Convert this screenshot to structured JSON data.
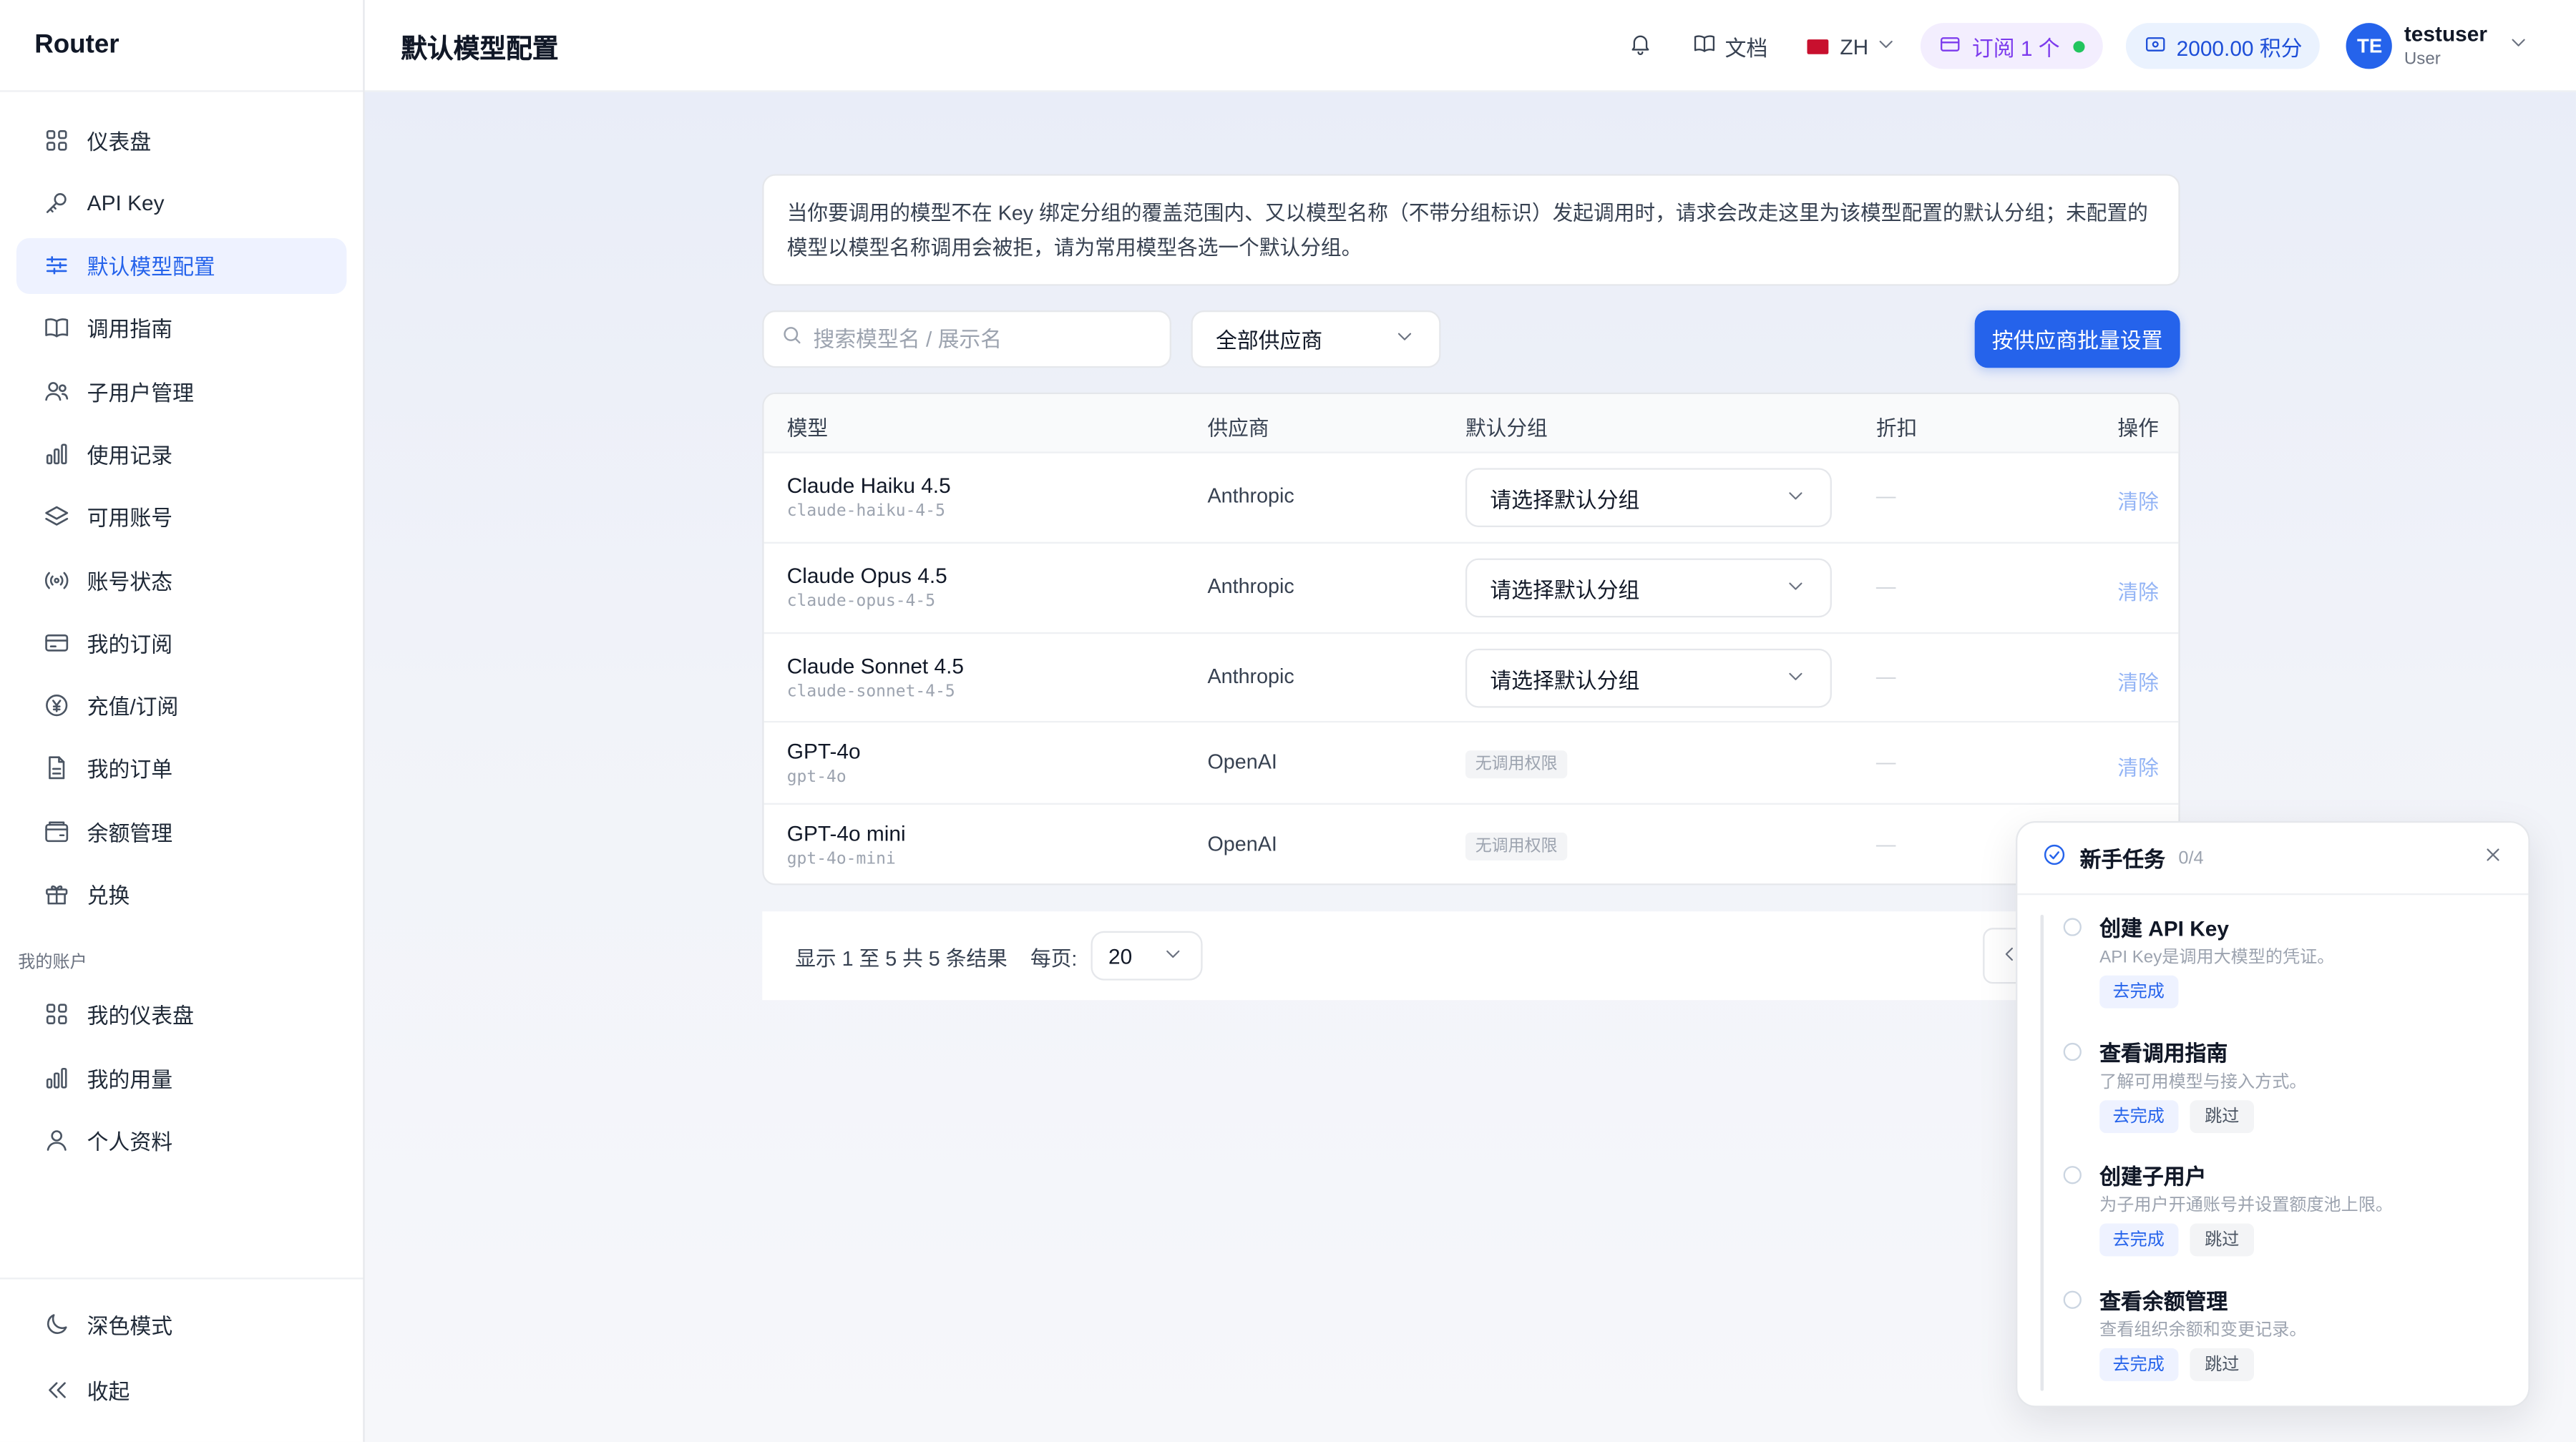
{
  "app": {
    "brand": "Router",
    "page_title": "默认模型配置"
  },
  "sidebar": {
    "items": [
      {
        "label": "仪表盘",
        "icon": "dashboard-icon"
      },
      {
        "label": "API Key",
        "icon": "key-icon"
      },
      {
        "label": "默认模型配置",
        "icon": "sliders-icon",
        "active": true
      },
      {
        "label": "调用指南",
        "icon": "book-icon"
      },
      {
        "label": "子用户管理",
        "icon": "users-icon"
      },
      {
        "label": "使用记录",
        "icon": "bar-chart-icon"
      },
      {
        "label": "可用账号",
        "icon": "layers-icon"
      },
      {
        "label": "账号状态",
        "icon": "signal-icon"
      },
      {
        "label": "我的订阅",
        "icon": "card-icon"
      },
      {
        "label": "充值/订阅",
        "icon": "yen-icon"
      },
      {
        "label": "我的订单",
        "icon": "file-icon"
      },
      {
        "label": "余额管理",
        "icon": "wallet-icon"
      },
      {
        "label": "兑换",
        "icon": "gift-icon"
      }
    ],
    "account_section_label": "我的账户",
    "account_items": [
      {
        "label": "我的仪表盘",
        "icon": "dashboard-icon"
      },
      {
        "label": "我的用量",
        "icon": "bar-chart-icon"
      },
      {
        "label": "个人资料",
        "icon": "user-icon"
      }
    ],
    "dark_mode_label": "深色模式",
    "collapse_label": "收起"
  },
  "header": {
    "docs_label": "文档",
    "language": "ZH",
    "subscription_label": "订阅 1 个",
    "points_label": "2000.00 积分",
    "avatar_initials": "TE",
    "user_name": "testuser",
    "user_role": "User"
  },
  "notice": "当你要调用的模型不在 Key 绑定分组的覆盖范围内、又以模型名称（不带分组标识）发起调用时，请求会改走这里为该模型配置的默认分组；未配置的模型以模型名称调用会被拒，请为常用模型各选一个默认分组。",
  "toolbar": {
    "search_placeholder": "搜索模型名 / 展示名",
    "vendor_filter": "全部供应商",
    "batch_button": "按供应商批量设置"
  },
  "table": {
    "headers": {
      "model": "模型",
      "vendor": "供应商",
      "group": "默认分组",
      "discount": "折扣",
      "action": "操作"
    },
    "rows": [
      {
        "name": "Claude Haiku 4.5",
        "id": "claude-haiku-4-5",
        "vendor": "Anthropic",
        "group": "请选择默认分组",
        "group_type": "select",
        "discount": "—",
        "action": "清除"
      },
      {
        "name": "Claude Opus 4.5",
        "id": "claude-opus-4-5",
        "vendor": "Anthropic",
        "group": "请选择默认分组",
        "group_type": "select",
        "discount": "—",
        "action": "清除"
      },
      {
        "name": "Claude Sonnet 4.5",
        "id": "claude-sonnet-4-5",
        "vendor": "Anthropic",
        "group": "请选择默认分组",
        "group_type": "select",
        "discount": "—",
        "action": "清除"
      },
      {
        "name": "GPT-4o",
        "id": "gpt-4o",
        "vendor": "OpenAI",
        "group": "无调用权限",
        "group_type": "badge",
        "discount": "—",
        "action": "清除"
      },
      {
        "name": "GPT-4o mini",
        "id": "gpt-4o-mini",
        "vendor": "OpenAI",
        "group": "无调用权限",
        "group_type": "badge",
        "discount": "—",
        "action": ""
      }
    ]
  },
  "pagination": {
    "summary": "显示 1 至 5 共 5 条结果",
    "per_page_label": "每页:",
    "per_page_value": "20"
  },
  "onboarding": {
    "title": "新手任务",
    "progress": "0/4",
    "tasks": [
      {
        "title": "创建 API Key",
        "desc": "API Key是调用大模型的凭证。",
        "go": "去完成",
        "skip": ""
      },
      {
        "title": "查看调用指南",
        "desc": "了解可用模型与接入方式。",
        "go": "去完成",
        "skip": "跳过"
      },
      {
        "title": "创建子用户",
        "desc": "为子用户开通账号并设置额度池上限。",
        "go": "去完成",
        "skip": "跳过"
      },
      {
        "title": "查看余额管理",
        "desc": "查看组织余额和变更记录。",
        "go": "去完成",
        "skip": "跳过"
      }
    ]
  },
  "colors": {
    "accent": "#2563eb",
    "subscription": "#7c3aed",
    "status_online": "#22c55e"
  }
}
